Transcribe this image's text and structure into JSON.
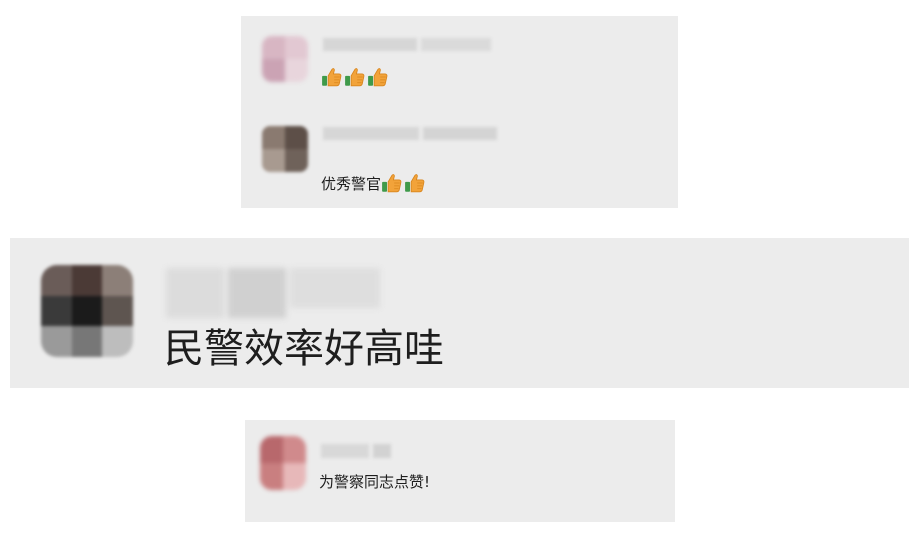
{
  "comments": [
    {
      "text": "",
      "emoji": [
        "thumbs-up-icon",
        "thumbs-up-icon",
        "thumbs-up-icon"
      ],
      "colors": {
        "avatar": [
          "#d8b6c3",
          "#e2c8d2",
          "#cba3b4",
          "#e8d5dc"
        ]
      }
    },
    {
      "text": "优秀警官",
      "emoji": [
        "thumbs-up-icon",
        "thumbs-up-icon"
      ],
      "colors": {
        "avatar": [
          "#8a7a70",
          "#5d4f48",
          "#a89a90",
          "#6f625a"
        ]
      }
    },
    {
      "text": "民警效率好高哇",
      "emoji": [],
      "colors": {
        "avatar": [
          "#6a5c58",
          "#4b3a36",
          "#8c7f78",
          "#3a3a3a",
          "#1b1b1b",
          "#5e5550",
          "#9a9a9a",
          "#777777",
          "#bdbdbd"
        ]
      }
    },
    {
      "text": "为警察同志点赞!",
      "emoji": [],
      "colors": {
        "avatar": [
          "#b8686c",
          "#d08a8c",
          "#c97f80",
          "#e7b8b9"
        ]
      }
    }
  ],
  "theme": {
    "card_bg": "#ececec",
    "blur_bar": "#d9d9d9",
    "text": "#1e1e1e"
  }
}
